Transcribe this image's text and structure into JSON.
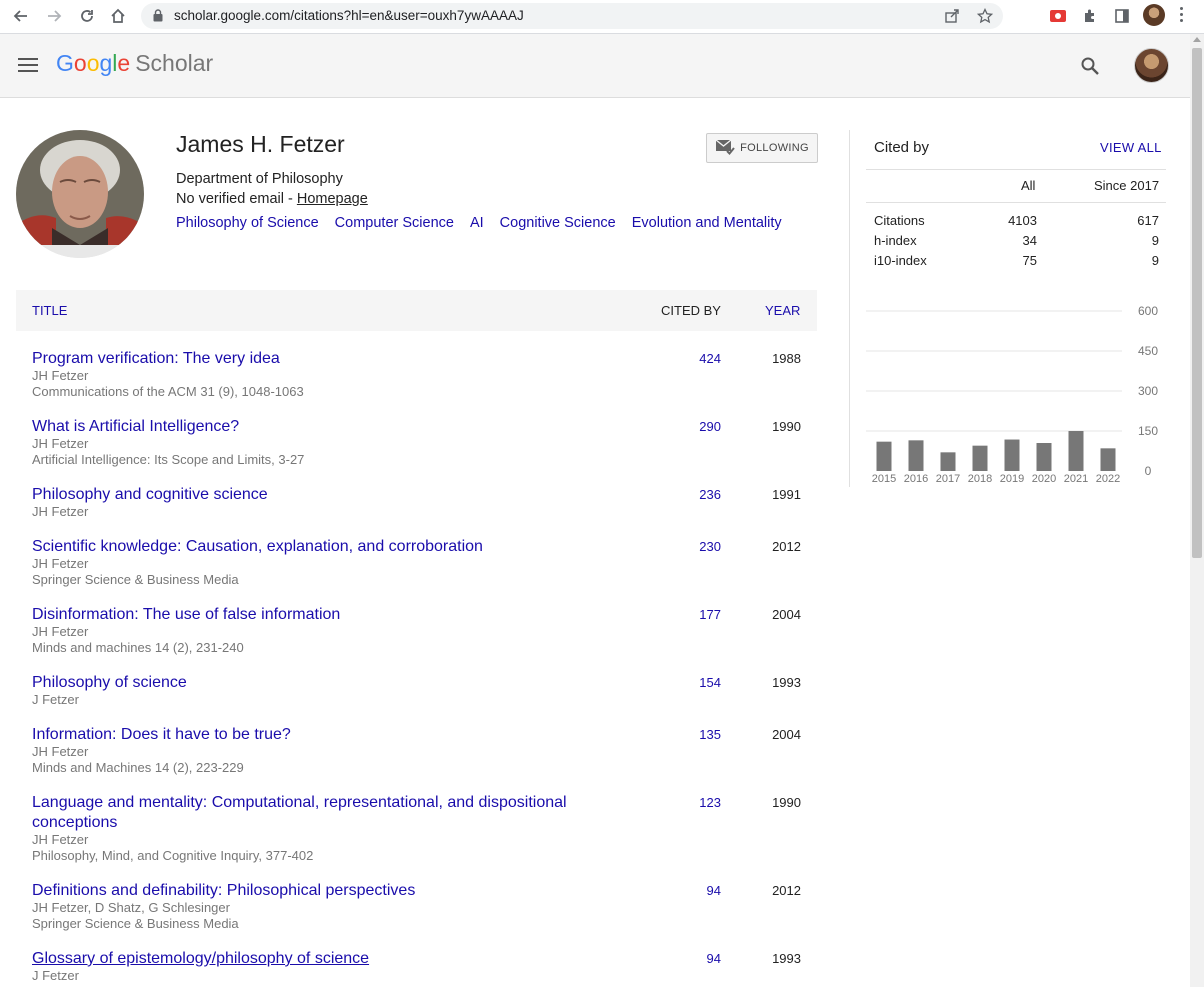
{
  "browser": {
    "url": "scholar.google.com/citations?hl=en&user=ouxh7ywAAAAJ"
  },
  "header": {
    "logo_google": [
      "G",
      "o",
      "o",
      "g",
      "l",
      "e"
    ],
    "logo_scholar": "Scholar"
  },
  "profile": {
    "name": "James H. Fetzer",
    "affiliation": "Department of Philosophy",
    "email_text": "No verified email - ",
    "homepage": "Homepage",
    "interests": [
      "Philosophy of Science",
      "Computer Science",
      "AI",
      "Cognitive Science",
      "Evolution and Mentality"
    ],
    "follow_label": "FOLLOWING"
  },
  "table": {
    "col_title": "TITLE",
    "col_cited": "CITED BY",
    "col_year": "YEAR",
    "rows": [
      {
        "title": "Program verification: The very idea",
        "authors": "JH Fetzer",
        "venue": "Communications of the ACM 31 (9), 1048-1063",
        "cited": "424",
        "year": "1988"
      },
      {
        "title": "What is Artificial Intelligence?",
        "authors": "JH Fetzer",
        "venue": "Artificial Intelligence: Its Scope and Limits, 3-27",
        "cited": "290",
        "year": "1990"
      },
      {
        "title": "Philosophy and cognitive science",
        "authors": "JH Fetzer",
        "venue": "",
        "cited": "236",
        "year": "1991"
      },
      {
        "title": "Scientific knowledge: Causation, explanation, and corroboration",
        "authors": "JH Fetzer",
        "venue": "Springer Science & Business Media",
        "cited": "230",
        "year": "2012"
      },
      {
        "title": "Disinformation: The use of false information",
        "authors": "JH Fetzer",
        "venue": "Minds and machines 14 (2), 231-240",
        "cited": "177",
        "year": "2004"
      },
      {
        "title": "Philosophy of science",
        "authors": "J Fetzer",
        "venue": "",
        "cited": "154",
        "year": "1993"
      },
      {
        "title": "Information: Does it have to be true?",
        "authors": "JH Fetzer",
        "venue": "Minds and Machines 14 (2), 223-229",
        "cited": "135",
        "year": "2004"
      },
      {
        "title": "Language and mentality: Computational, representational, and dispositional conceptions",
        "authors": "JH Fetzer",
        "venue": "Philosophy, Mind, and Cognitive Inquiry, 377-402",
        "cited": "123",
        "year": "1990"
      },
      {
        "title": "Definitions and definability: Philosophical perspectives",
        "authors": "JH Fetzer, D Shatz, G Schlesinger",
        "venue": "Springer Science & Business Media",
        "cited": "94",
        "year": "2012"
      },
      {
        "title": "Glossary of epistemology/philosophy of science",
        "authors": "J Fetzer",
        "venue": "",
        "cited": "94",
        "year": "1993"
      }
    ]
  },
  "citations": {
    "title": "Cited by",
    "view_all": "VIEW ALL",
    "col_all": "All",
    "col_since": "Since 2017",
    "rows": [
      {
        "label": "Citations",
        "all": "4103",
        "since": "617"
      },
      {
        "label": "h-index",
        "all": "34",
        "since": "9"
      },
      {
        "label": "i10-index",
        "all": "75",
        "since": "9"
      }
    ]
  },
  "chart_data": {
    "type": "bar",
    "categories": [
      "2015",
      "2016",
      "2017",
      "2018",
      "2019",
      "2020",
      "2021",
      "2022"
    ],
    "values": [
      110,
      115,
      70,
      95,
      118,
      105,
      150,
      85
    ],
    "yticks": [
      "600",
      "450",
      "300",
      "150",
      "0"
    ],
    "ylim": [
      0,
      600
    ],
    "bar_color": "#777777"
  },
  "colors": {
    "link": "#1a0dab",
    "header_bg": "#f5f5f5"
  }
}
